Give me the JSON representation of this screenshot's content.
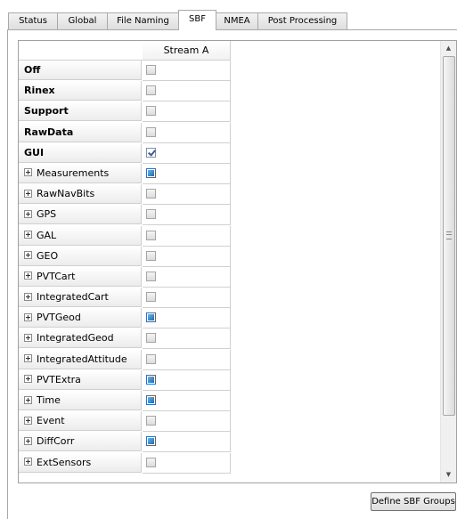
{
  "tabs": [
    {
      "label": "Status",
      "active": false
    },
    {
      "label": "Global",
      "active": false
    },
    {
      "label": "File Naming",
      "active": false
    },
    {
      "label": "SBF",
      "active": true
    },
    {
      "label": "NMEA",
      "active": false
    },
    {
      "label": "Post Processing",
      "active": false
    }
  ],
  "table": {
    "column_header": "Stream A",
    "rows": [
      {
        "label": "Off",
        "bold": true,
        "expandable": false,
        "state": "unchecked"
      },
      {
        "label": "Rinex",
        "bold": true,
        "expandable": false,
        "state": "unchecked"
      },
      {
        "label": "Support",
        "bold": true,
        "expandable": false,
        "state": "unchecked"
      },
      {
        "label": "RawData",
        "bold": true,
        "expandable": false,
        "state": "unchecked"
      },
      {
        "label": "GUI",
        "bold": true,
        "expandable": false,
        "state": "checked"
      },
      {
        "label": "Measurements",
        "bold": false,
        "expandable": true,
        "state": "partial"
      },
      {
        "label": "RawNavBits",
        "bold": false,
        "expandable": true,
        "state": "unchecked"
      },
      {
        "label": "GPS",
        "bold": false,
        "expandable": true,
        "state": "unchecked"
      },
      {
        "label": "GAL",
        "bold": false,
        "expandable": true,
        "state": "unchecked"
      },
      {
        "label": "GEO",
        "bold": false,
        "expandable": true,
        "state": "unchecked"
      },
      {
        "label": "PVTCart",
        "bold": false,
        "expandable": true,
        "state": "unchecked"
      },
      {
        "label": "IntegratedCart",
        "bold": false,
        "expandable": true,
        "state": "unchecked"
      },
      {
        "label": "PVTGeod",
        "bold": false,
        "expandable": true,
        "state": "partial"
      },
      {
        "label": "IntegratedGeod",
        "bold": false,
        "expandable": true,
        "state": "unchecked"
      },
      {
        "label": "IntegratedAttitude",
        "bold": false,
        "expandable": true,
        "state": "unchecked"
      },
      {
        "label": "PVTExtra",
        "bold": false,
        "expandable": true,
        "state": "partial"
      },
      {
        "label": "Time",
        "bold": false,
        "expandable": true,
        "state": "partial"
      },
      {
        "label": "Event",
        "bold": false,
        "expandable": true,
        "state": "unchecked"
      },
      {
        "label": "DiffCorr",
        "bold": false,
        "expandable": true,
        "state": "partial"
      },
      {
        "label": "ExtSensors",
        "bold": false,
        "expandable": true,
        "state": "unchecked"
      }
    ]
  },
  "scrollbar": {
    "up_icon": "scroll-up-arrow",
    "down_icon": "scroll-down-arrow"
  },
  "buttons": {
    "define_sbf_groups": "Define SBF Groups"
  }
}
